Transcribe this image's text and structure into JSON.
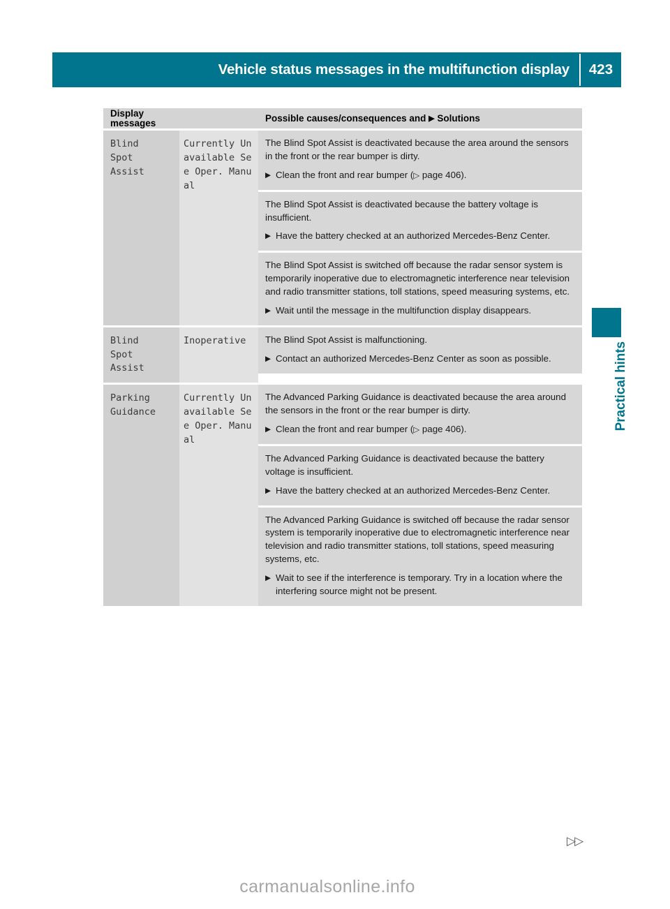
{
  "header": {
    "title": "Vehicle status messages in the multifunction display",
    "page_number": "423",
    "accent_color": "#00758D"
  },
  "side_tab": {
    "label": "Practical hints",
    "color": "#00758D"
  },
  "table": {
    "columns": {
      "display_messages": "Display messages",
      "causes_prefix": "Possible causes/consequences and",
      "causes_glyph": "▶",
      "causes_suffix": "Solutions"
    },
    "rows": [
      {
        "message": "Blind\nSpot\nAssist",
        "sub_message": "Currently Unavailable See Oper. Manual",
        "blocks": [
          {
            "cause": "The Blind Spot Assist is deactivated because the area around the sensors in the front or the rear bumper is dirty.",
            "solution_bullet": "▶",
            "solution_pre": "Clean the front and rear bumper (",
            "solution_ref_arrow": "▷",
            "solution_ref": " page 406",
            "solution_post": ")."
          },
          {
            "cause": "The Blind Spot Assist is deactivated because the battery voltage is insufficient.",
            "solution_bullet": "▶",
            "solution_pre": "Have the battery checked at an authorized Mercedes-Benz Center.",
            "solution_ref_arrow": "",
            "solution_ref": "",
            "solution_post": ""
          },
          {
            "cause": "The Blind Spot Assist is switched off because the radar sensor system is temporarily inoperative due to electromagnetic interference near television and radio transmitter stations, toll stations, speed measuring systems, etc.",
            "solution_bullet": "▶",
            "solution_pre": "Wait until the message in the multifunction display disappears.",
            "solution_ref_arrow": "",
            "solution_ref": "",
            "solution_post": ""
          }
        ]
      },
      {
        "message": "Blind\nSpot\nAssist",
        "sub_message": "Inoperative",
        "blocks": [
          {
            "cause": "The Blind Spot Assist is malfunctioning.",
            "solution_bullet": "▶",
            "solution_pre": "Contact an authorized Mercedes-Benz Center as soon as possible.",
            "solution_ref_arrow": "",
            "solution_ref": "",
            "solution_post": ""
          }
        ]
      },
      {
        "message": "Parking\nGuidance",
        "sub_message": "Currently Unavailable See Oper. Manual",
        "blocks": [
          {
            "cause": "The Advanced Parking Guidance is deactivated because the area around the sensors in the front or the rear bumper is dirty.",
            "solution_bullet": "▶",
            "solution_pre": "Clean the front and rear bumper (",
            "solution_ref_arrow": "▷",
            "solution_ref": " page 406",
            "solution_post": ")."
          },
          {
            "cause": "The Advanced Parking Guidance is deactivated because the battery voltage is insufficient.",
            "solution_bullet": "▶",
            "solution_pre": "Have the battery checked at an authorized Mercedes-Benz Center.",
            "solution_ref_arrow": "",
            "solution_ref": "",
            "solution_post": ""
          },
          {
            "cause": "The Advanced Parking Guidance is switched off because the radar sensor system is temporarily inoperative due to electromagnetic interference near television and radio transmitter stations, toll stations, speed measuring systems, etc.",
            "solution_bullet": "▶",
            "solution_pre": "Wait to see if the interference is temporary. Try in a location where the interfering source might not be present.",
            "solution_ref_arrow": "",
            "solution_ref": "",
            "solution_post": ""
          }
        ]
      }
    ]
  },
  "footer": {
    "next_page_marker": "▷▷",
    "watermark": "carmanualsonline.info"
  }
}
